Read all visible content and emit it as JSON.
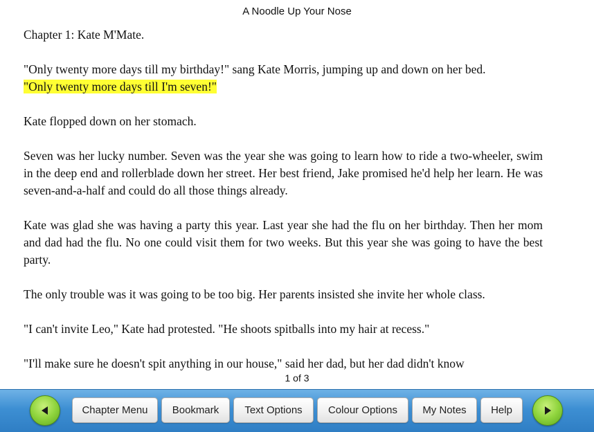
{
  "header": {
    "book_title": "A Noodle Up Your Nose"
  },
  "content": {
    "chapter_heading": "Chapter 1: Kate M'Mate.",
    "paragraph_1": "\"Only twenty more days till my birthday!\" sang Kate Morris, jumping up and down on her bed.",
    "paragraph_1_highlight": "\"Only twenty more days till I'm seven!\"",
    "paragraph_2": "Kate flopped down on her stomach.",
    "paragraph_3": "Seven was her lucky number. Seven was the year she was going to learn how to ride a two-wheeler, swim in the deep end and rollerblade down her street. Her best friend, Jake promised he'd help her learn. He was seven-and-a-half and could do all those things already.",
    "paragraph_4": "Kate was glad she was having a party this year. Last year she had the flu on her birthday. Then her mom and dad had the flu. No one could visit them for two weeks. But this year she was going to have the best party.",
    "paragraph_5": "The only trouble was it was going to be too big. Her parents insisted she invite her whole class.",
    "paragraph_6": "\"I can't invite Leo,\" Kate had protested. \"He shoots spitballs into my hair at recess.\"",
    "paragraph_7": "\"I'll make sure he doesn't spit anything in our house,\" said her dad, but her dad didn't know",
    "highlight_color": "#ffff33"
  },
  "pagination": {
    "label": "1 of 3"
  },
  "toolbar": {
    "prev_icon": "arrow-left-icon",
    "next_icon": "arrow-right-icon",
    "chapter_menu_label": "Chapter Menu",
    "bookmark_label": "Bookmark",
    "text_options_label": "Text Options",
    "colour_options_label": "Colour Options",
    "my_notes_label": "My Notes",
    "help_label": "Help",
    "bar_color": "#3d8fd3",
    "nav_button_color": "#8fd43d"
  }
}
